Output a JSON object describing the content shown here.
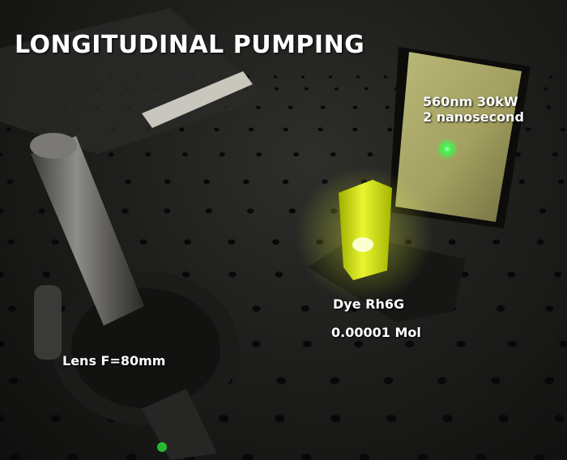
{
  "image": {
    "title": "LONGITUDINAL PUMPING",
    "spec_line_1": "560nm 30kW",
    "spec_line_2": "2 nanosecond",
    "dye_label": "Dye Rh6G",
    "concentration_label": "0.00001 Mol",
    "lens_label": "Lens F=80mm"
  },
  "colors": {
    "table": "#1e1e1c",
    "hole": "#080808",
    "cuvette": "#d8e800",
    "screen": "#a8a868",
    "laser_spot": "#39ff4a"
  }
}
